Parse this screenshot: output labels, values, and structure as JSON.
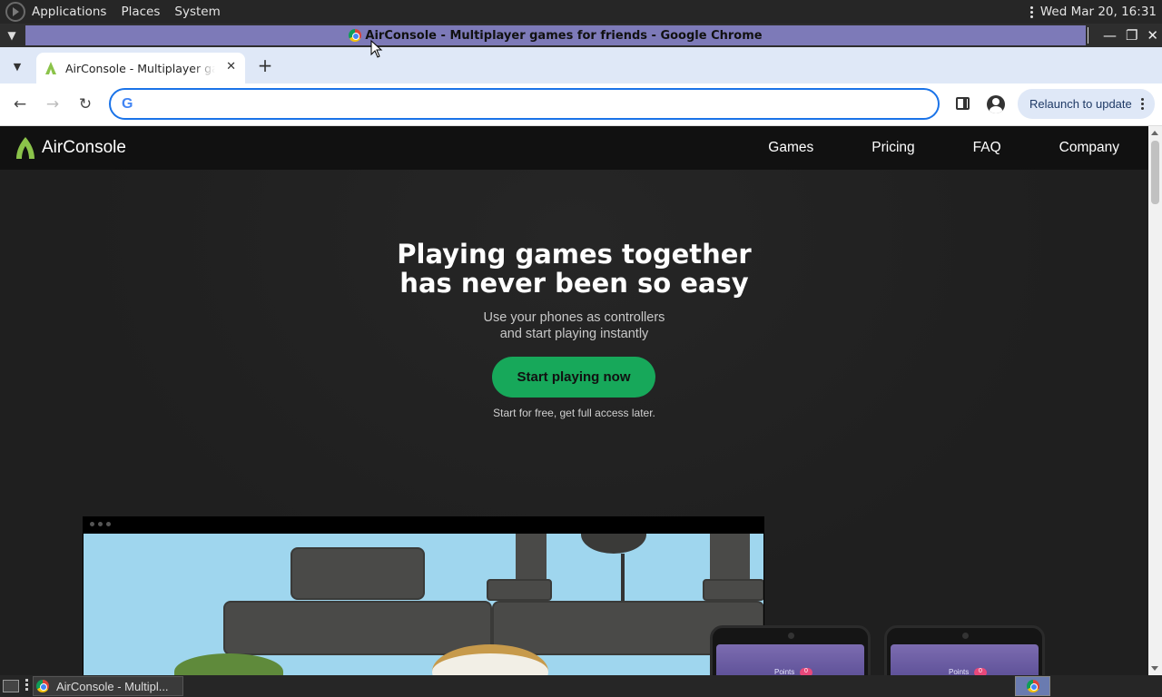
{
  "system_panel": {
    "menu": [
      "Applications",
      "Places",
      "System"
    ],
    "clock": "Wed Mar 20, 16:31"
  },
  "window": {
    "title": "AirConsole - Multiplayer games for friends - Google Chrome",
    "minimize": "—",
    "maximize": "❐",
    "close": "✕"
  },
  "tabs": {
    "list_button": "⌄",
    "active_title": "AirConsole - Multiplayer games for friends",
    "close": "✕",
    "new_tab": "+"
  },
  "toolbar": {
    "back": "←",
    "forward": "→",
    "reload": "↻",
    "omnibox_logo": "G",
    "omnibox_value": "",
    "relaunch_label": "Relaunch to update"
  },
  "site": {
    "brand": "AirConsole",
    "nav": [
      "Games",
      "Pricing",
      "FAQ",
      "Company"
    ],
    "hero_line1": "Playing games together",
    "hero_line2": "has never been so easy",
    "sub_line1": "Use your phones as controllers",
    "sub_line2": "and start playing instantly",
    "cta": "Start playing now",
    "cta_note": "Start for free, get full access later.",
    "phone_label": "Points",
    "phone_badge": "0"
  },
  "taskbar": {
    "task_title": "AirConsole - Multipl..."
  },
  "colors": {
    "accent_green": "#17a85a",
    "title_bar_active": "#7d7ab8",
    "omnibox_focus": "#1a73e8"
  }
}
